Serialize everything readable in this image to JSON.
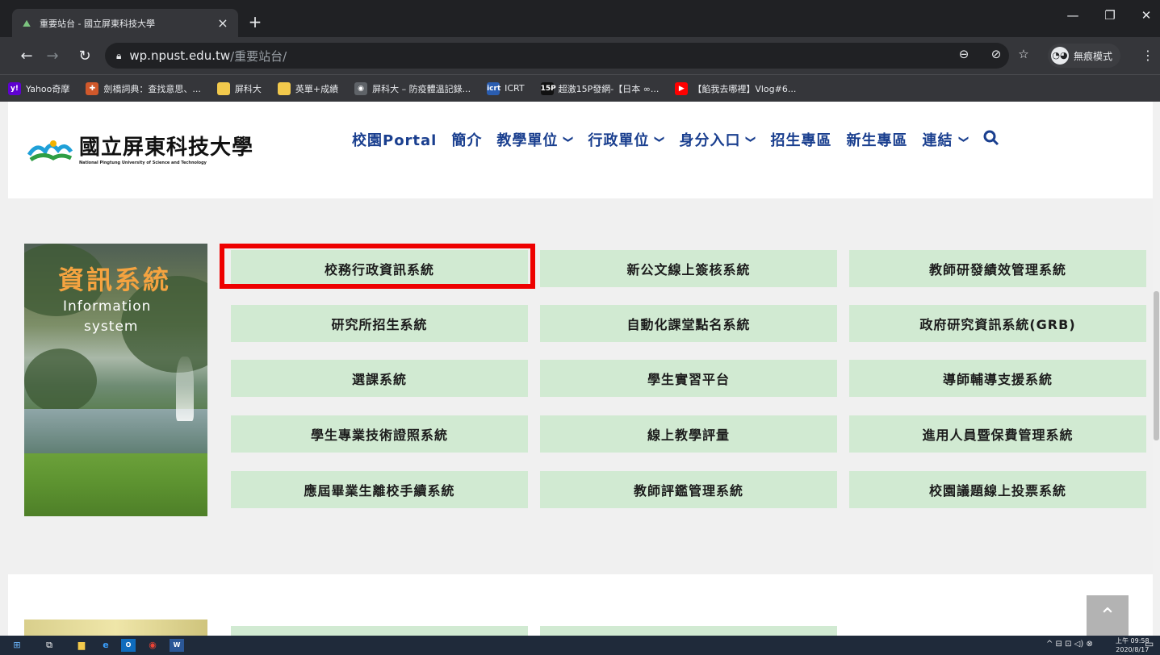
{
  "browser": {
    "tab_title": "重要站台 - 國立屏東科技大學",
    "tab_close": "×",
    "new_tab": "+",
    "window_controls": {
      "minimize": "—",
      "restore": "❐",
      "close": "✕"
    },
    "url_host": "wp.npust.edu.tw",
    "url_path": "/重要站台/",
    "incognito_label": "無痕模式",
    "bookmarks": [
      {
        "label": "Yahoo奇摩",
        "icon": "yahoo-icon",
        "color": "#5f01d1",
        "glyph": "y!"
      },
      {
        "label": "劍橋詞典：查找意思、...",
        "icon": "cambridge-icon",
        "color": "#d0582b",
        "glyph": "✚"
      },
      {
        "label": "屏科大",
        "icon": "folder-icon",
        "color": "#f2c94c",
        "glyph": ""
      },
      {
        "label": "英單+成績",
        "icon": "folder-icon",
        "color": "#f2c94c",
        "glyph": ""
      },
      {
        "label": "屏科大 – 防疫體溫記錄...",
        "icon": "globe-icon",
        "color": "#5f6368",
        "glyph": "◉"
      },
      {
        "label": "ICRT",
        "icon": "icrt-icon",
        "color": "#2a5db0",
        "glyph": "icrt"
      },
      {
        "label": "超激15P發網-【日本 ∞...",
        "icon": "15p-icon",
        "color": "#111111",
        "glyph": "15P"
      },
      {
        "label": "【餡我去哪裡】Vlog#6...",
        "icon": "youtube-icon",
        "color": "#ff0000",
        "glyph": "▶"
      }
    ]
  },
  "site": {
    "logo_zh": "國立屏東科技大學",
    "logo_en": "National Pingtung University of Science and Technology",
    "nav": [
      {
        "label": "校園Portal",
        "dropdown": false
      },
      {
        "label": "簡介",
        "dropdown": false
      },
      {
        "label": "教學單位",
        "dropdown": true
      },
      {
        "label": "行政單位",
        "dropdown": true
      },
      {
        "label": "身分入口",
        "dropdown": true
      },
      {
        "label": "招生專區",
        "dropdown": false
      },
      {
        "label": "新生專區",
        "dropdown": false
      },
      {
        "label": "連結",
        "dropdown": true
      }
    ],
    "chevron": "⌄",
    "search_glyph": "⚲",
    "section": {
      "title_zh": "資訊系統",
      "title_en_line1": "Information",
      "title_en_line2": "system"
    },
    "systems": [
      "校務行政資訊系統",
      "新公文線上簽核系統",
      "教師研發績效管理系統",
      "研究所招生系統",
      "自動化課堂點名系統",
      "政府研究資訊系統(GRB)",
      "選課系統",
      "學生實習平台",
      "導師輔導支援系統",
      "學生專業技術證照系統",
      "線上教學評量",
      "進用人員暨保費管理系統",
      "應屆畢業生離校手續系統",
      "教師評鑑管理系統",
      "校園議題線上投票系統"
    ],
    "highlighted_system_index": 0,
    "scroll_top": "⌃"
  },
  "taskbar": {
    "tray_icons": "^ ⊟ ⊡ ◁) ⊗",
    "time": "上午 09:58",
    "date": "2020/8/17",
    "notify": "▭"
  },
  "colors": {
    "button_bg": "#d1ead2",
    "nav_text": "#1a3f8f",
    "highlight": "#ee0000",
    "section_title": "#f4a340"
  }
}
